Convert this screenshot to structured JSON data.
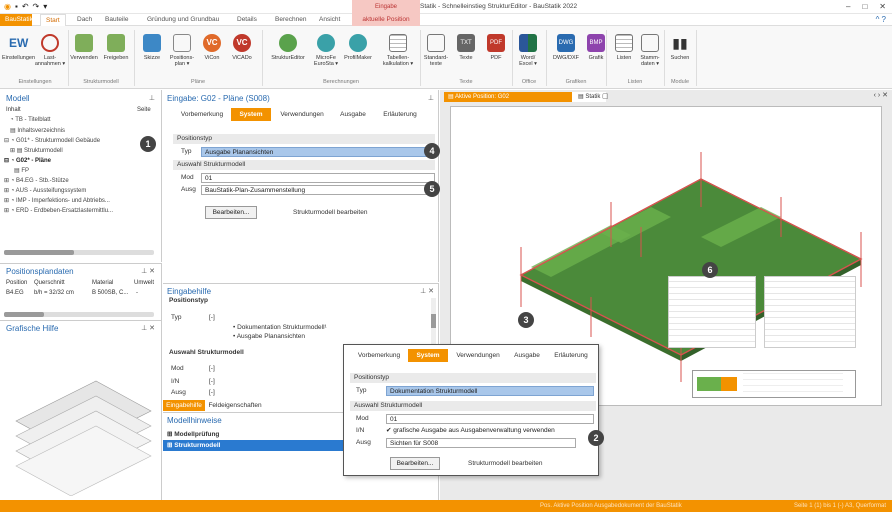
{
  "window": {
    "title": "Statik - Schnelleinstieg StrukturEditor - BauStatik 2022",
    "context_group": "Eingabe",
    "controls": [
      "–",
      "□",
      "✕"
    ],
    "help": "^  ?"
  },
  "tabs": [
    {
      "label": "BauStatik"
    },
    {
      "label": "Start"
    },
    {
      "label": "Dach"
    },
    {
      "label": "Bauteile"
    },
    {
      "label": "Gründung und Grundbau"
    },
    {
      "label": "Details"
    },
    {
      "label": "Berechnen"
    },
    {
      "label": "Ansicht"
    },
    {
      "label": "aktuelle Position"
    }
  ],
  "ribbon": {
    "buttons": [
      {
        "icon": "EW",
        "label": "Einstellungen"
      },
      {
        "icon": "download-icon",
        "label": "Last-\nannahmen ▾"
      },
      {
        "icon": "link-icon",
        "label": "Verwenden"
      },
      {
        "icon": "release-icon",
        "label": "Freigeben"
      },
      {
        "icon": "sketch-icon",
        "label": "Skizze"
      },
      {
        "icon": "plan-icon",
        "label": "Positions-\nplan ▾"
      },
      {
        "icon": "VC",
        "label": "ViCon"
      },
      {
        "icon": "VC",
        "label": "ViCADo"
      },
      {
        "icon": "structure-editor-icon",
        "label": "StrukturEditor"
      },
      {
        "icon": "microfe-icon",
        "label": "MicroFe\nEuroSta ▾"
      },
      {
        "icon": "profilmaker-icon",
        "label": "ProfilMaker"
      },
      {
        "icon": "table-icon",
        "label": "Tabellen-\nkalkulation ▾"
      },
      {
        "icon": "text-icon",
        "label": "Standard-\ntexte"
      },
      {
        "icon": "TXT",
        "label": "Texte"
      },
      {
        "icon": "PDF",
        "label": "PDF"
      },
      {
        "icon": "word-icon",
        "label": "Word/\nExcel ▾"
      },
      {
        "icon": "DWG",
        "label": "DWG/DXF"
      },
      {
        "icon": "BMP",
        "label": "Grafik"
      },
      {
        "icon": "list-icon",
        "label": "Listen"
      },
      {
        "icon": "master-data-icon",
        "label": "Stamm-\ndaten ▾"
      },
      {
        "icon": "binoculars-icon",
        "label": "Suchen"
      }
    ],
    "groups": [
      "Einstellungen",
      "Strukturmodell",
      "Pläne",
      "Berechnungen",
      "Texte",
      "Office",
      "Grafiken",
      "Listen",
      "Module"
    ]
  },
  "model_panel": {
    "title": "Modell",
    "col_inhalt": "Inhalt",
    "col_seite": "Seite",
    "items": [
      {
        "label": "TB - Titelblatt"
      },
      {
        "label": "Inhaltsverzeichnis"
      },
      {
        "label": "G01* - Strukturmodell Gebäude"
      },
      {
        "label": "Strukturmodell"
      },
      {
        "label": "G02* - Pläne"
      },
      {
        "label": "FP"
      },
      {
        "label": "B4.EG - Stb.-Stütze"
      },
      {
        "label": "AUS - Aussteifungssystem"
      },
      {
        "label": "IMP - Imperfektions- und Abtriebs..."
      },
      {
        "label": "ERD - Erdbeben-Ersatzlastermittlu..."
      }
    ]
  },
  "positions_panel": {
    "title": "Positionsplandaten",
    "headers": [
      "Position",
      "Querschnitt",
      "Material",
      "Umwelt"
    ],
    "row": [
      "B4.EG",
      "b/h = 32/32 cm",
      "B 500SB, C...",
      "-"
    ]
  },
  "graphic_help": {
    "title": "Grafische Hilfe"
  },
  "input_panel": {
    "title": "Eingabe: G02 - Pläne (S008)",
    "subtabs": [
      "Vorbemerkung",
      "System",
      "Verwendungen",
      "Ausgabe",
      "Erläuterung"
    ],
    "section1": "Positionstyp",
    "typ_label": "Typ",
    "typ_value": "Ausgabe Planansichten",
    "section2": "Auswahl Strukturmodell",
    "mod_label": "Mod",
    "mod_value": "01",
    "ausg_label": "Ausg",
    "ausg_value": "BauStatik-Plan-Zusammenstellung",
    "edit_button": "Bearbeiten...",
    "edit_caption": "Strukturmodell bearbeiten"
  },
  "help_panel": {
    "title": "Eingabehilfe",
    "heading": "Positionstyp",
    "typ_label": "Typ",
    "typ_value": "[-]",
    "bullets": [
      "• Dokumentation Strukturmodell¹",
      "• Ausgabe Planansichten"
    ],
    "heading2": "Auswahl Strukturmodell",
    "rows": [
      {
        "k": "Mod",
        "v": "[-]"
      },
      {
        "k": "I/N",
        "v": "[-]"
      },
      {
        "k": "Ausg",
        "v": "[-]"
      }
    ],
    "tabs": [
      "Eingabehilfe",
      "Feldeigenschaften"
    ]
  },
  "hints_panel": {
    "title": "Modellhinweise",
    "items": [
      "Modellprüfung",
      "Strukturmodell"
    ]
  },
  "view_tabs": [
    "Aktive Position: G02",
    "Statik"
  ],
  "popup": {
    "subtabs": [
      "Vorbemerkung",
      "System",
      "Verwendungen",
      "Ausgabe",
      "Erläuterung"
    ],
    "section1": "Positionstyp",
    "typ_label": "Typ",
    "typ_value": "Dokumentation Strukturmodell",
    "section2": "Auswahl Strukturmodell",
    "mod_label": "Mod",
    "mod_value": "01",
    "in_label": "I/N",
    "in_value": "grafische Ausgabe aus Ausgabenverwaltung verwenden",
    "ausg_label": "Ausg",
    "ausg_value": "Sichten für S008",
    "edit_button": "Bearbeiten...",
    "edit_caption": "Strukturmodell bearbeiten"
  },
  "callouts": [
    "1",
    "2",
    "3",
    "4",
    "5",
    "6"
  ],
  "statusbar": {
    "left": "Pos. Aktive Position  Ausgabedokument der BauStatik",
    "right": "Seite 1 (1) bis 1 (-) A3, Querformat"
  },
  "colors": {
    "accent": "#f39200",
    "blue": "#2a6bb0",
    "select": "#a9c7ea"
  }
}
